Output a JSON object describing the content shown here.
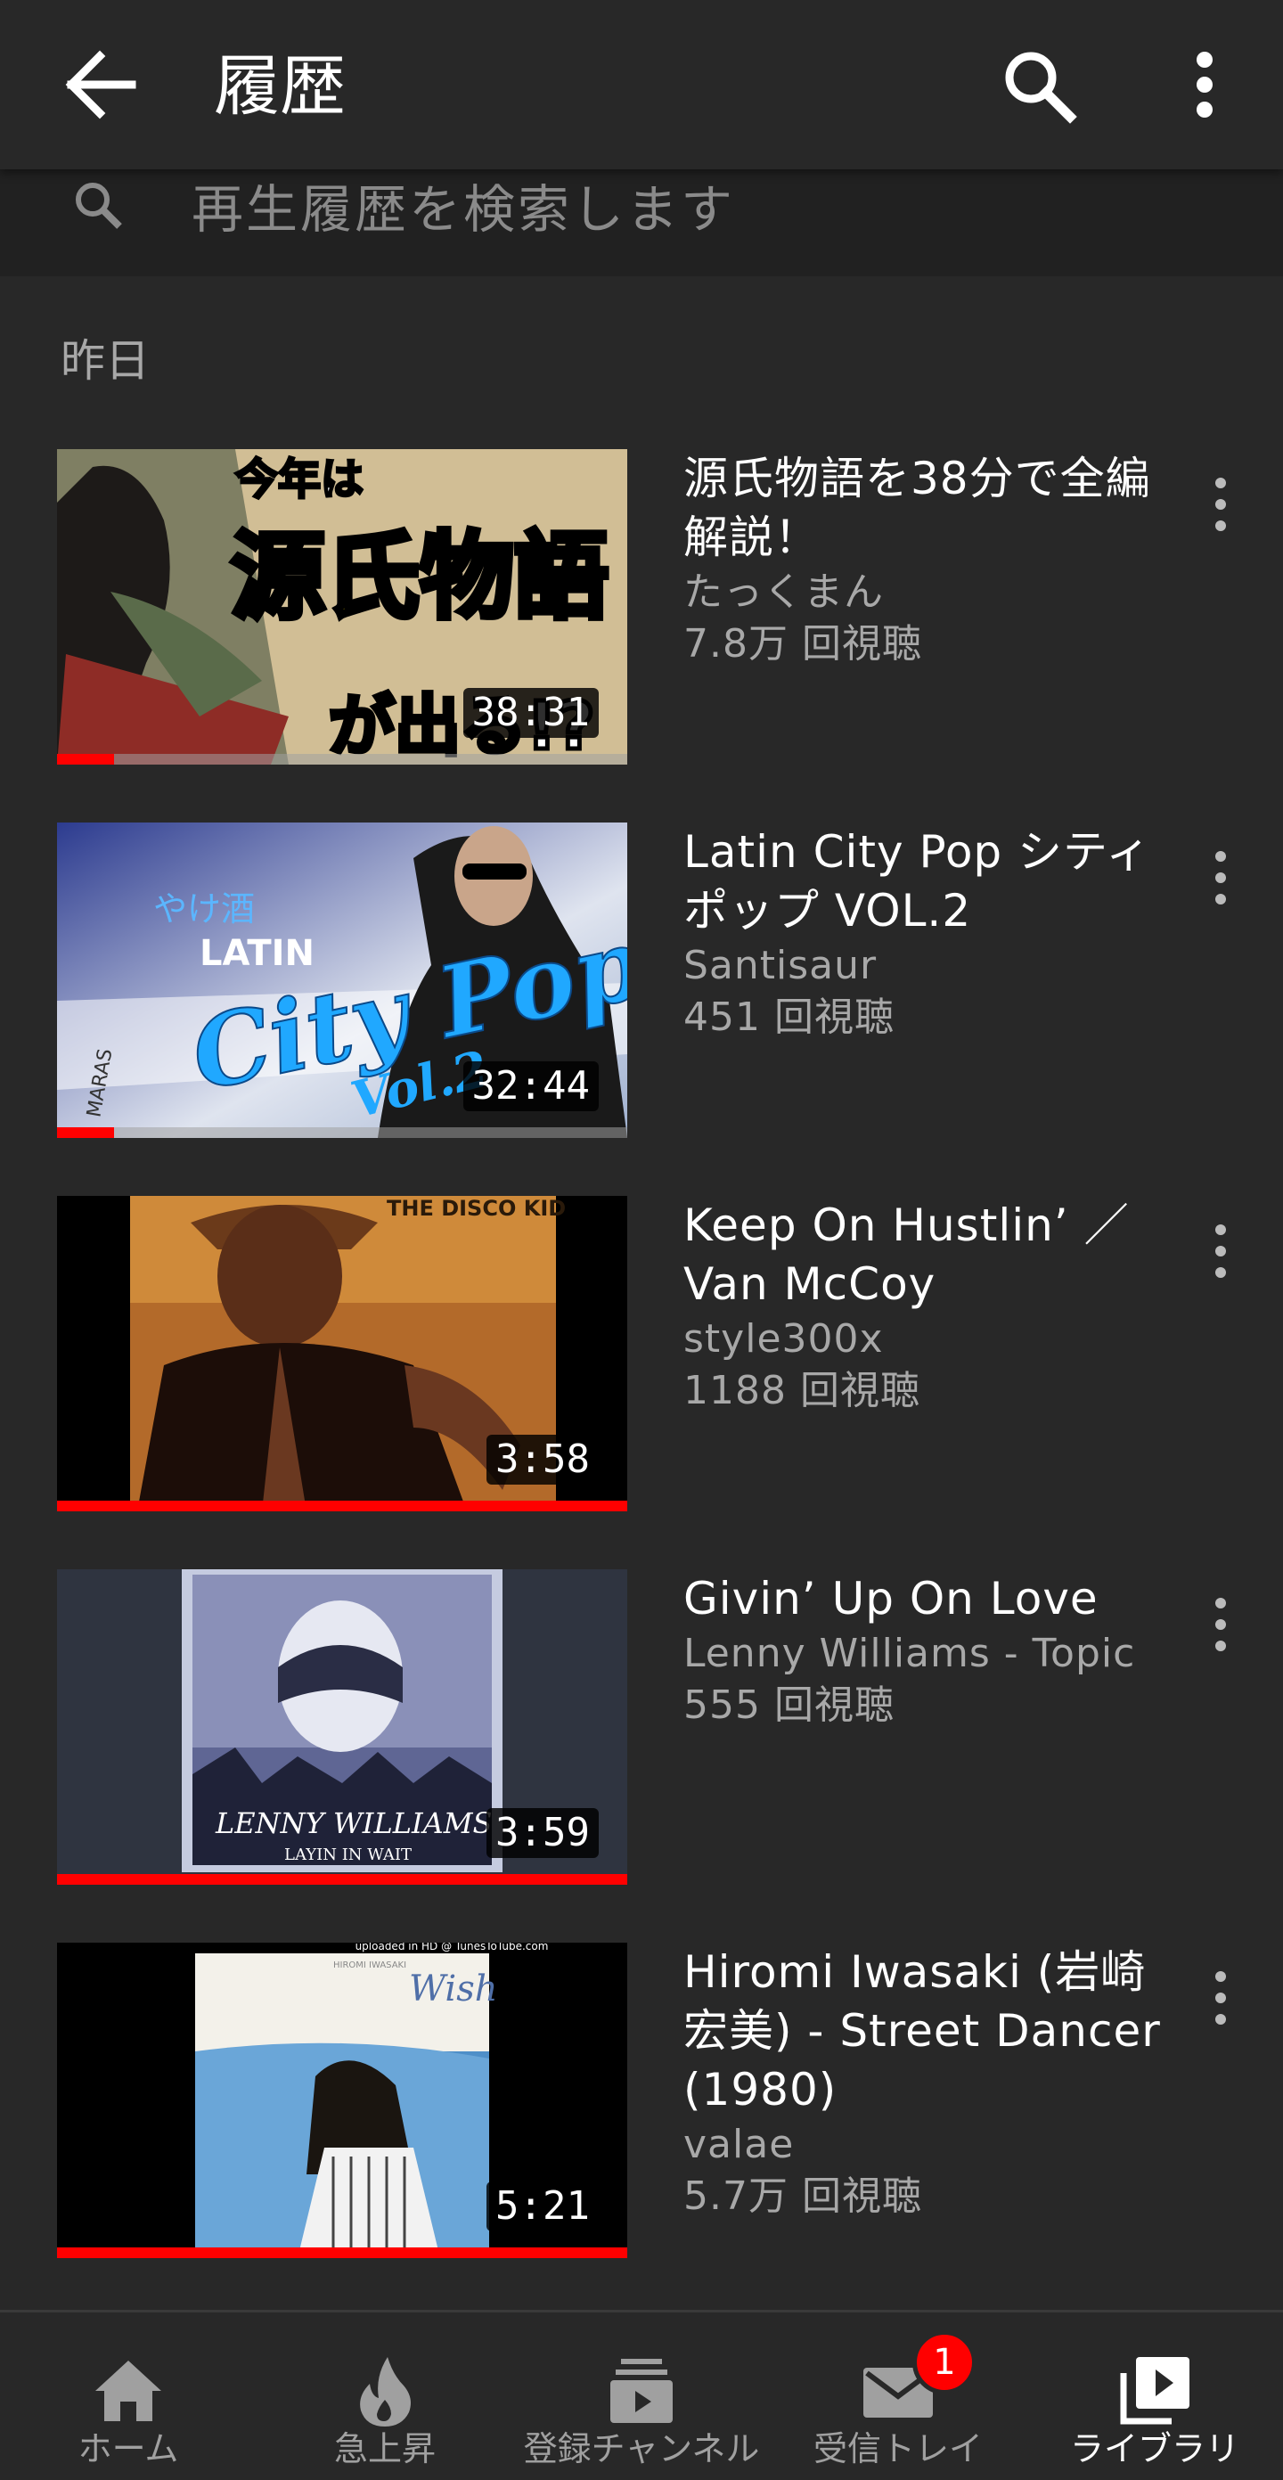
{
  "app_bar": {
    "title": "履歴",
    "back_icon": "arrow-left-icon",
    "search_icon": "search-icon",
    "more_icon": "more-vert-icon"
  },
  "search": {
    "placeholder": "再生履歴を検索します",
    "icon": "search-icon"
  },
  "section": {
    "label": "昨日"
  },
  "videos": [
    {
      "title": "源氏物語を38分で全編解説！",
      "channel": "たっくまん",
      "views": "7.8万 回視聴",
      "duration": "38:31",
      "watched_fraction": 0.1,
      "thumb_text": [
        "今年は",
        "源氏物語",
        "が出る!?"
      ]
    },
    {
      "title": "Latin City Pop シティポップ VOL.2",
      "channel": "Santisaur",
      "views": "451 回視聴",
      "duration": "32:44",
      "watched_fraction": 0.1,
      "thumb_text": [
        "やけ酒",
        "LATIN",
        "City Pop",
        "Vol.2",
        "MARAS"
      ]
    },
    {
      "title": "Keep On Hustlin’ ／ Van McCoy",
      "channel": "style300x",
      "views": "1188 回視聴",
      "duration": "3:58",
      "watched_fraction": 1.0,
      "thumb_text": [
        "THE DISCO KID"
      ]
    },
    {
      "title": "Givin’ Up On Love",
      "channel": "Lenny Williams - Topic",
      "views": "555 回視聴",
      "duration": "3:59",
      "watched_fraction": 1.0,
      "thumb_text": [
        "LENNY WILLIAMS",
        "LAYIN IN WAIT"
      ]
    },
    {
      "title": "Hiromi Iwasaki (岩崎宏美) - Street Dancer (1980)",
      "channel": "valae",
      "views": "5.7万 回視聴",
      "duration": "5:21",
      "watched_fraction": 1.0,
      "thumb_text": [
        "uploaded in HD @ TunesToTube.com",
        "HIROMI IWASAKI",
        "Wish"
      ]
    }
  ],
  "bottom_nav": [
    {
      "label": "ホーム",
      "icon": "home-icon",
      "active": false
    },
    {
      "label": "急上昇",
      "icon": "flame-icon",
      "active": false
    },
    {
      "label": "登録チャンネル",
      "icon": "subscriptions-icon",
      "active": false
    },
    {
      "label": "受信トレイ",
      "icon": "mail-icon",
      "active": false,
      "badge": "1"
    },
    {
      "label": "ライブラリ",
      "icon": "library-icon",
      "active": true
    }
  ],
  "colors": {
    "background": "#282828",
    "progress": "#ff0000",
    "secondary_text": "#a8a8a8"
  }
}
